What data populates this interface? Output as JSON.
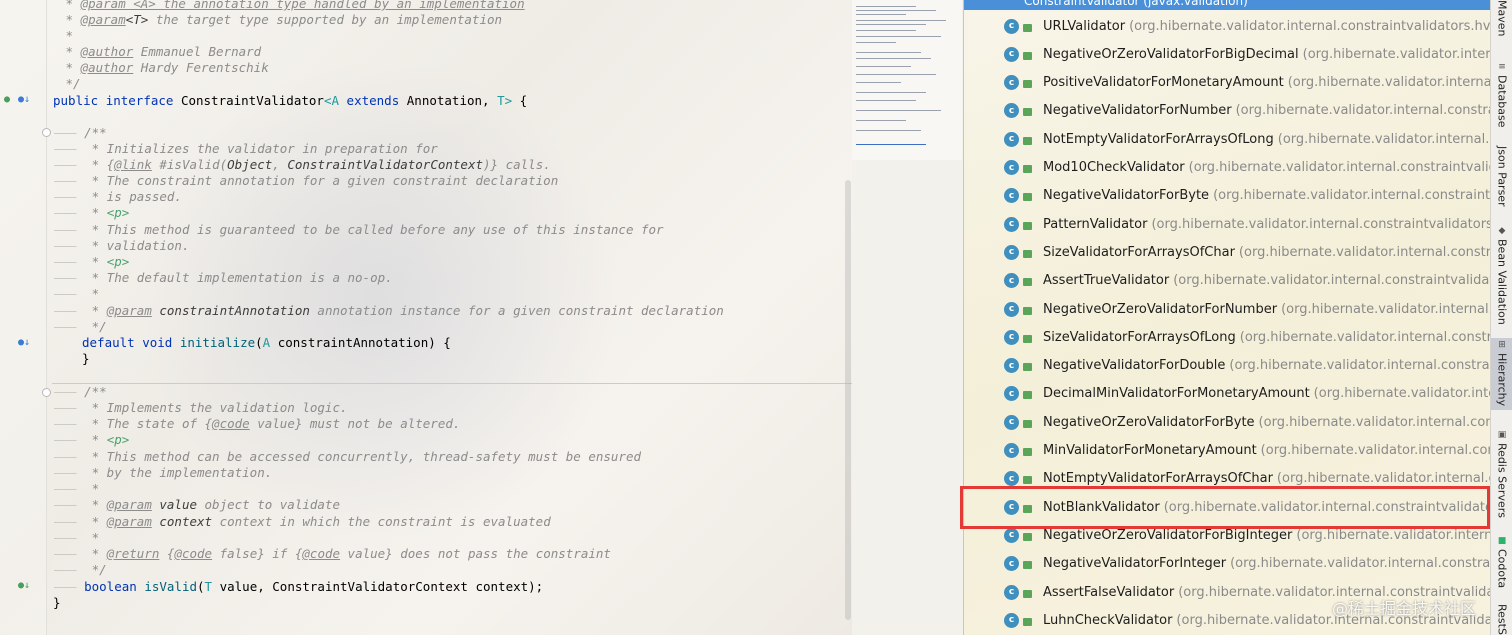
{
  "editor": {
    "lines": {
      "l1": "@param <A> the annotation type handled by an implementation",
      "l2_tag": "@param",
      "l2_name": "<T>",
      "l2_text": " the target type supported by an implementation",
      "l4_tag": "@author",
      "l4_text": " Emmanuel Bernard",
      "l5_tag": "@author",
      "l5_text": " Hardy Ferentschik",
      "l6": " */",
      "decl_kw1": "public",
      "decl_kw2": "interface",
      "decl_name": "ConstraintValidator",
      "decl_tp": "<A",
      "decl_kw3": "extends",
      "decl_ann": "Annotation,",
      "decl_t": "T>",
      "decl_end": " {",
      "c1": "/**",
      "c2": " * Initializes the validator in preparation for",
      "c3_link": "@link",
      "c3_pre": " * {",
      "c3_mid": " #isValid(",
      "c3_obj": "Object",
      "c3_comma": ", ",
      "c3_ctx": "ConstraintValidatorContext",
      "c3_end": ")} calls.",
      "c4": " * The constraint annotation for a given constraint declaration",
      "c5": " * is passed.",
      "c6_pre": " * ",
      "c6_p": "<p>",
      "c7": " * This method is guaranteed to be called before any use of this instance for",
      "c8": " * validation.",
      "c9_pre": " * ",
      "c9_p": "<p>",
      "c10": " * The default implementation is a no-op.",
      "c11": " *",
      "c12_pre": " * ",
      "c12_tag": "@param",
      "c12_name": " constraintAnnotation",
      "c12_text": " annotation instance for a given constraint declaration",
      "c13": " */",
      "m1_kw1": "default",
      "m1_kw2": "void",
      "m1_fn": "initialize",
      "m1_open": "(",
      "m1_tp": "A",
      "m1_rest": " constraintAnnotation) {",
      "m1_close": "}",
      "d1": "/**",
      "d2": " * Implements the validation logic.",
      "d3_pre": " * The state of {",
      "d3_tag": "@code",
      "d3_rest": " value} must not be altered.",
      "d4_pre": " * ",
      "d4_p": "<p>",
      "d5": " * This method can be accessed concurrently, thread-safety must be ensured",
      "d6": " * by the implementation.",
      "d7": " *",
      "d8_pre": " * ",
      "d8_tag": "@param",
      "d8_name": " value",
      "d8_text": " object to validate",
      "d9_pre": " * ",
      "d9_tag": "@param",
      "d9_name": " context",
      "d9_text": " context in which the constraint is evaluated",
      "d10": " *",
      "d11_pre": " * ",
      "d11_tag": "@return",
      "d11_a": " {",
      "d11_code1": "@code",
      "d11_b": " false} if {",
      "d11_code2": "@code",
      "d11_c": " value} does not pass the constraint",
      "d12": " */",
      "m2_kw": "boolean",
      "m2_fn": "isValid",
      "m2_open": "(",
      "m2_tp": "T",
      "m2_rest": " value, ConstraintValidatorContext context);",
      "end": "}"
    }
  },
  "hierarchy": {
    "header": "ConstraintValidator (javax.validation)",
    "items": [
      {
        "name": "URLValidator",
        "pkg": "(org.hibernate.validator.internal.constraintvalidators.hv)"
      },
      {
        "name": "NegativeOrZeroValidatorForBigDecimal",
        "pkg": "(org.hibernate.validator.internal.cons"
      },
      {
        "name": "PositiveValidatorForMonetaryAmount",
        "pkg": "(org.hibernate.validator.internal.constr"
      },
      {
        "name": "NegativeValidatorForNumber",
        "pkg": "(org.hibernate.validator.internal.constraintvalic"
      },
      {
        "name": "NotEmptyValidatorForArraysOfLong",
        "pkg": "(org.hibernate.validator.internal.constrai"
      },
      {
        "name": "Mod10CheckValidator",
        "pkg": "(org.hibernate.validator.internal.constraintvalidators.h"
      },
      {
        "name": "NegativeValidatorForByte",
        "pkg": "(org.hibernate.validator.internal.constraintvalidato"
      },
      {
        "name": "PatternValidator",
        "pkg": "(org.hibernate.validator.internal.constraintvalidators.bv)"
      },
      {
        "name": "SizeValidatorForArraysOfChar",
        "pkg": "(org.hibernate.validator.internal.constraintvalid"
      },
      {
        "name": "AssertTrueValidator",
        "pkg": "(org.hibernate.validator.internal.constraintvalidators.bv)"
      },
      {
        "name": "NegativeOrZeroValidatorForNumber",
        "pkg": "(org.hibernate.validator.internal.constra"
      },
      {
        "name": "SizeValidatorForArraysOfLong",
        "pkg": "(org.hibernate.validator.internal.constraintvalid"
      },
      {
        "name": "NegativeValidatorForDouble",
        "pkg": "(org.hibernate.validator.internal.constraintvalid"
      },
      {
        "name": "DecimalMinValidatorForMonetaryAmount",
        "pkg": "(org.hibernate.validator.internal.co"
      },
      {
        "name": "NegativeOrZeroValidatorForByte",
        "pkg": "(org.hibernate.validator.internal.constraintv"
      },
      {
        "name": "MinValidatorForMonetaryAmount",
        "pkg": "(org.hibernate.validator.internal.constraint"
      },
      {
        "name": "NotEmptyValidatorForArraysOfChar",
        "pkg": "(org.hibernate.validator.internal.constrai"
      },
      {
        "name": "NotBlankValidator",
        "pkg": "(org.hibernate.validator.internal.constraintvalidators.bv)"
      },
      {
        "name": "NegativeOrZeroValidatorForBigInteger",
        "pkg": "(org.hibernate.validator.internal.const"
      },
      {
        "name": "NegativeValidatorForInteger",
        "pkg": "(org.hibernate.validator.internal.constraintvalida"
      },
      {
        "name": "AssertFalseValidator",
        "pkg": "(org.hibernate.validator.internal.constraintvalidators.bv)"
      },
      {
        "name": "LuhnCheckValidator",
        "pkg": "(org.hibernate.validator.internal.constraintvalidators.bv)"
      }
    ],
    "class_icon_letter": "c",
    "highlight_color": "#e53935"
  },
  "tools": {
    "maven": "Maven",
    "database": "Database",
    "json": "Json Parser",
    "bean": "Bean Validation",
    "hierarchy": "Hierarchy",
    "redis": "Redis Servers",
    "codota": "Codota",
    "rest": "RestS"
  },
  "watermark": "@稀土掘金技术社区"
}
